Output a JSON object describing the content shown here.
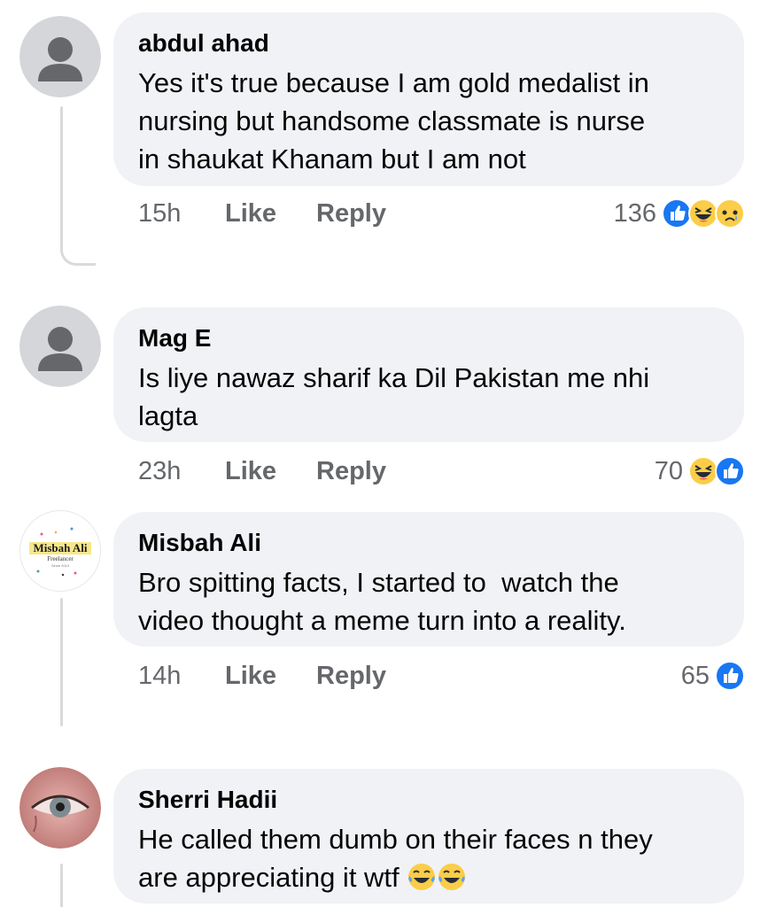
{
  "comments": [
    {
      "author": "abdul ahad",
      "text_lines": [
        "Yes it's true because I am gold medalist in",
        "nursing but handsome classmate is nurse",
        "in shaukat Khanam but I am not"
      ],
      "time": "15h",
      "like_label": "Like",
      "reply_label": "Reply",
      "reaction_count": "136",
      "reactions": [
        "like-icon",
        "haha-icon",
        "sad-icon"
      ]
    },
    {
      "author": "Mag E",
      "text_lines": [
        "Is liye nawaz sharif ka Dil Pakistan me nhi",
        "lagta"
      ],
      "time": "23h",
      "like_label": "Like",
      "reply_label": "Reply",
      "reaction_count": "70",
      "reactions": [
        "haha-icon",
        "like-icon"
      ]
    },
    {
      "author": "Misbah Ali",
      "avatar_text": {
        "name": "Misbah Ali",
        "subtitle": "Freelancer",
        "tagline": "Since 2014"
      },
      "text_lines": [
        "Bro spitting facts, I started to  watch the",
        "video thought a meme turn into a reality."
      ],
      "time": "14h",
      "like_label": "Like",
      "reply_label": "Reply",
      "reaction_count": "65",
      "reactions": [
        "like-icon"
      ]
    },
    {
      "author": "Sherri Hadii",
      "text_lines": [
        "He called them dumb on their faces n they",
        "are appreciating it wtf"
      ],
      "inline_emojis": [
        "tears-of-joy-icon",
        "tears-of-joy-icon"
      ]
    }
  ],
  "colors": {
    "bubble": "#f0f2f5",
    "meta_text": "#65676b",
    "like_blue": "#1877f2",
    "emoji_yellow": "#fbcd48"
  }
}
